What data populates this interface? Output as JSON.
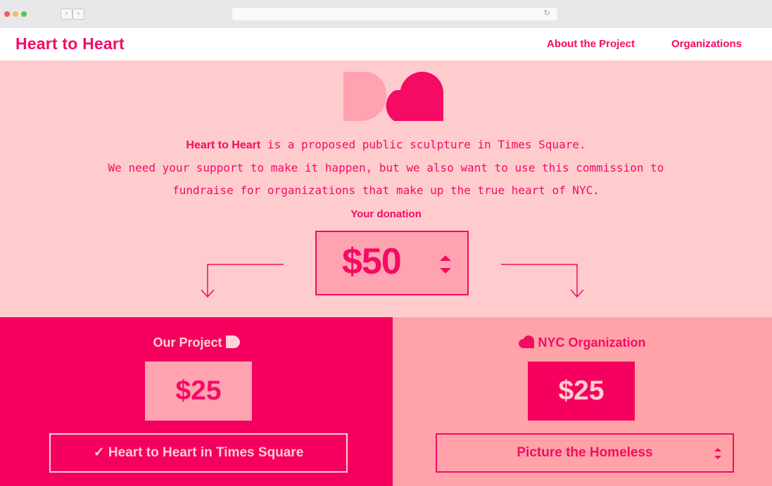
{
  "browser": {
    "back_glyph": "‹",
    "forward_glyph": "›",
    "reload_glyph": "↻"
  },
  "header": {
    "title": "Heart to Heart",
    "nav": [
      {
        "label": "About the Project"
      },
      {
        "label": "Organizations"
      }
    ]
  },
  "intro": {
    "bold": "Heart to Heart",
    "line1_rest": " is a proposed public sculpture in Times Square.",
    "line2": "We need your support to make it happen, but we also want to use this commission to",
    "line3": "fundraise for organizations that make up the true heart of NYC."
  },
  "donation": {
    "label": "Your donation",
    "amount": "$50"
  },
  "project": {
    "title": "Our Project",
    "amount": "$25",
    "selection": "✓ Heart to Heart in Times Square",
    "icon": "half-heart-icon"
  },
  "organization": {
    "title": "NYC Organization",
    "amount": "$25",
    "selection": "Picture the Homeless",
    "icon": "heart-icon"
  },
  "colors": {
    "brand": "#f50a64",
    "background": "#ffccce",
    "light_panel": "#ffa3a9"
  }
}
